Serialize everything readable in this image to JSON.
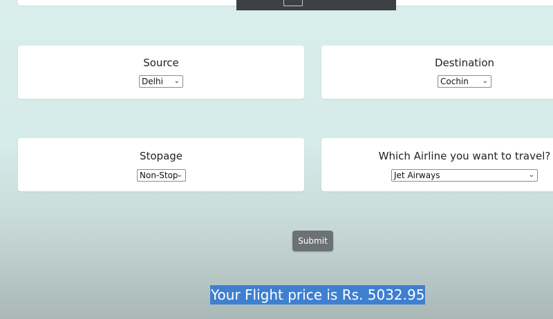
{
  "form": {
    "source": {
      "label": "Source",
      "selected": "Delhi"
    },
    "destination": {
      "label": "Destination",
      "selected": "Cochin"
    },
    "stopage": {
      "label": "Stopage",
      "selected": "Non-Stop"
    },
    "airline": {
      "label": "Which Airline you want to travel?",
      "selected": "Jet Airways"
    },
    "submit_label": "Submit"
  },
  "result": {
    "text": "Your Flight price is Rs. 5032.95"
  },
  "icons": {
    "dropdown": "chevron-down-icon"
  }
}
